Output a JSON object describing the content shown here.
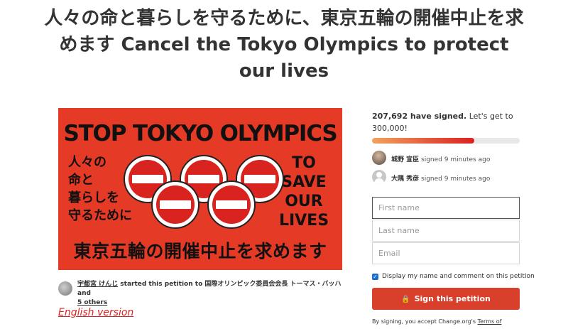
{
  "petition": {
    "title": "人々の命と暮らしを守るために、東京五輪の開催中止を求めます Cancel the Tokyo Olympics to protect our lives"
  },
  "banner": {
    "headline": "STOP TOKYO OLYMPICS",
    "left_lines": [
      "人々の",
      "命と",
      "暮らしを",
      "守るために"
    ],
    "right_lines": [
      "TO",
      "SAVE",
      "OUR",
      "LIVES"
    ],
    "footer": "東京五輪の開催中止を求めます"
  },
  "starter": {
    "name": "宇都宮 けんじ",
    "started_text": "started this petition to",
    "recipient": "国際オリンピック委員会会長 トーマス・バッハ",
    "and_text": "and",
    "others": "5 others"
  },
  "english_link": "English version",
  "signatures": {
    "count_text": "207,692 have signed.",
    "goal_text": "Let's get to 300,000!",
    "progress": 0.69
  },
  "recent_signers": [
    {
      "name": "城野 宣臣",
      "text": "signed 9 minutes ago",
      "avatar": "photo"
    },
    {
      "name": "大隅 秀彦",
      "text": "signed 9 minutes ago",
      "avatar": "default-user-icon"
    }
  ],
  "form": {
    "first_name_placeholder": "First name",
    "last_name_placeholder": "Last name",
    "email_placeholder": "Email",
    "display_checkbox_label": "Display my name and comment on this petition",
    "display_checked": true,
    "sign_button": "Sign this petition",
    "lock_icon": "lock-icon",
    "terms_text": "By signing, you accept Change.org's",
    "terms_link": "Terms of"
  },
  "colors": {
    "banner_bg": "#e53a25",
    "accent": "#d8402b",
    "checkbox": "#1a6fd1"
  }
}
